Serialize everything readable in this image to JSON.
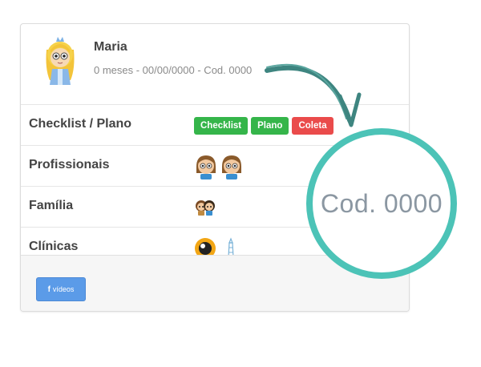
{
  "profile": {
    "name": "Maria",
    "meta": "0 meses - 00/00/0000 - Cod. 0000"
  },
  "rows": [
    {
      "label": "Checklist / Plano"
    },
    {
      "label": "Profissionais"
    },
    {
      "label": "Família"
    },
    {
      "label": "Clínicas"
    }
  ],
  "buttons": {
    "checklist": "Checklist",
    "plano": "Plano",
    "coleta": "Coleta"
  },
  "footer": {
    "facebook_icon": "f",
    "videos": "vídeos"
  },
  "zoom": {
    "text": "Cod. 0000"
  },
  "colors": {
    "accent_teal": "#4cc3b7",
    "arrow": "#3e8580",
    "green": "#35b54a",
    "red": "#ea4b4b",
    "blue": "#5b9be8"
  },
  "icons": {
    "avatar": "princess-avatar-icon",
    "profissionais": "professional-person-icon",
    "familia": "family-icon",
    "clinica_1": "orange-eye-icon",
    "clinica_2": "lighthouse-icon"
  }
}
